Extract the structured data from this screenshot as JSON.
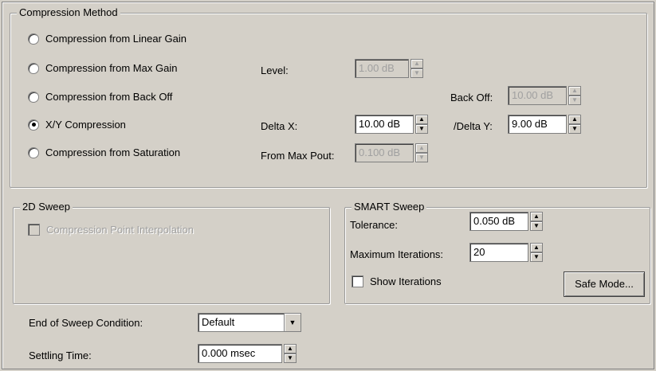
{
  "compression_method": {
    "legend": "Compression Method",
    "options": [
      {
        "label": "Compression from Linear Gain",
        "selected": false
      },
      {
        "label": "Compression from Max Gain",
        "selected": false
      },
      {
        "label": "Compression from Back Off",
        "selected": false
      },
      {
        "label": "X/Y Compression",
        "selected": true
      },
      {
        "label": "Compression from Saturation",
        "selected": false
      }
    ],
    "level": {
      "label": "Level:",
      "value": "1.00 dB"
    },
    "back_off": {
      "label": "Back Off:",
      "value": "10.00 dB"
    },
    "delta_x": {
      "label": "Delta X:",
      "value": "10.00 dB"
    },
    "delta_y": {
      "label": "/Delta Y:",
      "value": "9.00 dB"
    },
    "from_max_pout": {
      "label": "From Max Pout:",
      "value": "0.100 dB"
    }
  },
  "sweep_2d": {
    "legend": "2D Sweep",
    "interpolation_label": "Compression Point Interpolation"
  },
  "smart_sweep": {
    "legend": "SMART Sweep",
    "tolerance": {
      "label": "Tolerance:",
      "value": "0.050 dB"
    },
    "max_iterations": {
      "label": "Maximum Iterations:",
      "value": "20"
    },
    "show_iterations_label": "Show Iterations",
    "safe_mode_label": "Safe Mode..."
  },
  "end_of_sweep": {
    "label": "End of Sweep Condition:",
    "value": "Default"
  },
  "settling_time": {
    "label": "Settling Time:",
    "value": "0.000 msec"
  },
  "icons": {
    "spin_up": "▲",
    "spin_down": "▼",
    "dropdown": "▼"
  }
}
